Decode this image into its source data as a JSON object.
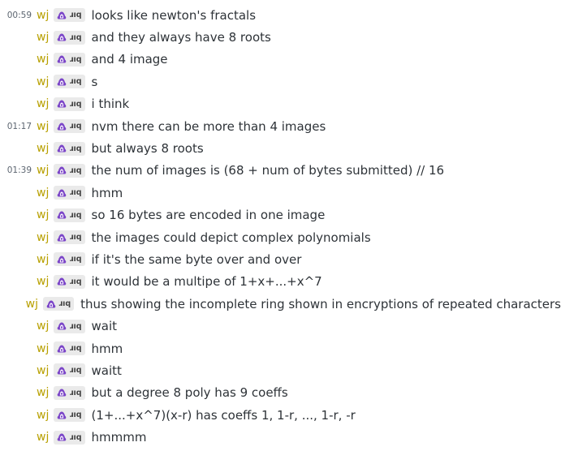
{
  "messages": [
    {
      "time": "00:59",
      "user": "wj",
      "tag": "ɹıq",
      "text": "looks like newton's fractals"
    },
    {
      "time": "",
      "user": "wj",
      "tag": "ɹıq",
      "text": "and they always have 8 roots"
    },
    {
      "time": "",
      "user": "wj",
      "tag": "ɹıq",
      "text": "and 4 image"
    },
    {
      "time": "",
      "user": "wj",
      "tag": "ɹıq",
      "text": "s"
    },
    {
      "time": "",
      "user": "wj",
      "tag": "ɹıq",
      "text": "i think"
    },
    {
      "time": "01:17",
      "user": "wj",
      "tag": "ɹıq",
      "text": "nvm there can be more than 4 images"
    },
    {
      "time": "",
      "user": "wj",
      "tag": "ɹıq",
      "text": "but always 8 roots"
    },
    {
      "time": "01:39",
      "user": "wj",
      "tag": "ɹıq",
      "text": "the num of images is (68 + num of bytes submitted) // 16"
    },
    {
      "time": "",
      "user": "wj",
      "tag": "ɹıq",
      "text": "hmm"
    },
    {
      "time": "",
      "user": "wj",
      "tag": "ɹıq",
      "text": "so 16 bytes are encoded in one image"
    },
    {
      "time": "",
      "user": "wj",
      "tag": "ɹıq",
      "text": "the images could depict complex polynomials"
    },
    {
      "time": "",
      "user": "wj",
      "tag": "ɹıq",
      "text": "if it's the same byte over and over"
    },
    {
      "time": "",
      "user": "wj",
      "tag": "ɹıq",
      "text": "it would be a multipe of 1+x+...+x^7"
    },
    {
      "time": "",
      "user": "wj",
      "tag": "ɹıq",
      "text": "thus showing the incomplete ring shown in encryptions of repeated characters"
    },
    {
      "time": "",
      "user": "wj",
      "tag": "ɹıq",
      "text": "wait"
    },
    {
      "time": "",
      "user": "wj",
      "tag": "ɹıq",
      "text": "hmm"
    },
    {
      "time": "",
      "user": "wj",
      "tag": "ɹıq",
      "text": "waitt"
    },
    {
      "time": "",
      "user": "wj",
      "tag": "ɹıq",
      "text": "but a degree 8 poly has 9 coeffs"
    },
    {
      "time": "",
      "user": "wj",
      "tag": "ɹıq",
      "text": "(1+...+x^7)(x-r) has coeffs 1, 1-r, ..., 1-r, -r"
    },
    {
      "time": "",
      "user": "wj",
      "tag": "ɹıq",
      "text": "hmmmm"
    }
  ],
  "tag_icon": "purple-blob-icon",
  "colors": {
    "username": "#b8a000",
    "timestamp": "#5c6570",
    "message": "#2e3338",
    "tag_bg": "#eaeaea",
    "icon_purple": "#7b45c8"
  }
}
